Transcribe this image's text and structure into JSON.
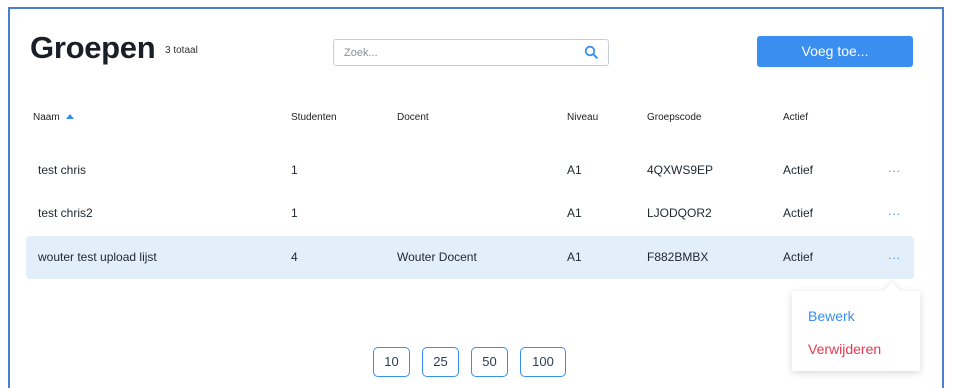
{
  "header": {
    "title": "Groepen",
    "count": "3 totaal",
    "add_button": "Voeg toe..."
  },
  "search": {
    "placeholder": "Zoek...",
    "icon": "search-icon"
  },
  "table": {
    "columns": [
      "Naam",
      "Studenten",
      "Docent",
      "Niveau",
      "Groepscode",
      "Actief"
    ],
    "sorted_column": "Naam",
    "rows": [
      {
        "name": "test chris",
        "students": "1",
        "teacher": "",
        "level": "A1",
        "code": "4QXWS9EP",
        "active": "Actief",
        "more": "..."
      },
      {
        "name": "test chris2",
        "students": "1",
        "teacher": "",
        "level": "A1",
        "code": "LJODQOR2",
        "active": "Actief",
        "more": "..."
      },
      {
        "name": "wouter test upload lijst",
        "students": "4",
        "teacher": "Wouter Docent",
        "level": "A1",
        "code": "F882BMBX",
        "active": "Actief",
        "more": "..."
      }
    ]
  },
  "context_menu": {
    "edit": "Bewerk",
    "delete": "Verwijderen"
  },
  "pagination": {
    "sizes": [
      "10",
      "25",
      "50",
      "100"
    ]
  },
  "colors": {
    "accent": "#3a8ef0",
    "danger": "#e8384f",
    "selected_row": "#e3eefb"
  }
}
